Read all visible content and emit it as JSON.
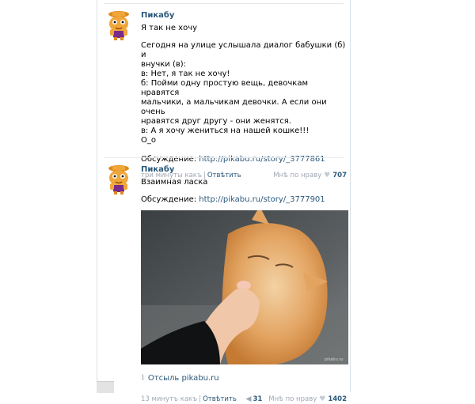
{
  "posts": [
    {
      "author": "Пикабу",
      "title": "Я так не хочу",
      "lines": [
        "Сегодня на улице услышала диалог бабушки (б) и",
        "внучки (в):",
        "в: Нет, я так не хочу!",
        "б: Пойми одну простую вещь, девочкам нравятся",
        "мальчики, а мальчикам девочки. А если они очень",
        "нравятся друг другу - они женятся.",
        "в: А я хочу жениться на нашей кошке!!!",
        "О_о"
      ],
      "discussion_label": "Обсуждение:",
      "discussion_link": "http://pikabu.ru/story/_3777861",
      "time": "три минуты какъ",
      "reply": "Отвѣтить",
      "like_label": "Мнѣ по нраву",
      "like_count": "707"
    },
    {
      "author": "Пикабу",
      "title": "Взаимная ласка",
      "discussion_label": "Обсуждение:",
      "discussion_link": "http://pikabu.ru/story/_3777901",
      "source": "Отсыль pikabu.ru",
      "time": "13 минутъ какъ",
      "reply": "Отвѣтить",
      "repost_count": "31",
      "like_label": "Мнѣ по нраву",
      "like_count": "1402"
    }
  ],
  "colors": {
    "link": "#2b587a",
    "meta": "#a0a8b3",
    "border": "#dae1e8"
  },
  "icons": {
    "avatar": "pikabu-mascot",
    "heart": "heart-icon",
    "repost": "megaphone-icon",
    "source": "pin-icon"
  }
}
